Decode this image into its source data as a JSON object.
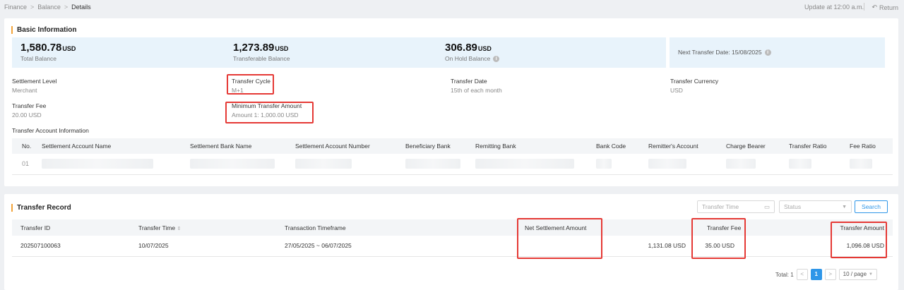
{
  "breadcrumb": [
    "Finance",
    "Balance",
    "Details"
  ],
  "header": {
    "update": "Update at 12:00 a.m.",
    "return_label": "Return"
  },
  "basic": {
    "title": "Basic Information",
    "balances": [
      {
        "amount": "1,580.78",
        "unit": "USD",
        "label": "Total Balance"
      },
      {
        "amount": "1,273.89",
        "unit": "USD",
        "label": "Transferable Balance"
      },
      {
        "amount": "306.89",
        "unit": "USD",
        "label": "On Hold Balance"
      }
    ],
    "next_transfer": "Next Transfer Date: 15/08/2025",
    "fields": [
      {
        "key": "Settlement Level",
        "value": "Merchant"
      },
      {
        "key": "Transfer Cycle",
        "value": "M+1"
      },
      {
        "key": "Transfer Date",
        "value": "15th of each month"
      },
      {
        "key": "Transfer Currency",
        "value": "USD"
      },
      {
        "key": "Transfer Fee",
        "value": "20.00 USD"
      },
      {
        "key": "Minimum Transfer Amount",
        "value": "Amount 1: 1,000.00 USD"
      }
    ],
    "account_title": "Transfer Account Information",
    "account_columns": [
      "No.",
      "Settlement Account Name",
      "Settlement Bank Name",
      "Settlement Account Number",
      "Beneficiary Bank",
      "Remitting Bank",
      "Bank Code",
      "Remitter's Account",
      "Charge Bearer",
      "Transfer Ratio",
      "Fee Ratio"
    ],
    "account_row_no": "01"
  },
  "record": {
    "title": "Transfer Record",
    "filter_time_placeholder": "Transfer Time",
    "filter_status_placeholder": "Status",
    "search_label": "Search",
    "columns": [
      "Transfer ID",
      "Transfer Time",
      "Transaction Timeframe",
      "Net Settlement Amount",
      "Transfer Fee",
      "Transfer Amount"
    ],
    "rows": [
      {
        "id": "202507100063",
        "time": "10/07/2025",
        "timeframe": "27/05/2025 ~ 06/07/2025",
        "net": "1,131.08 USD",
        "fee": "35.00 USD",
        "amount": "1,096.08 USD"
      }
    ],
    "total": "Total: 1",
    "page": "1",
    "page_size": "10 / page"
  }
}
